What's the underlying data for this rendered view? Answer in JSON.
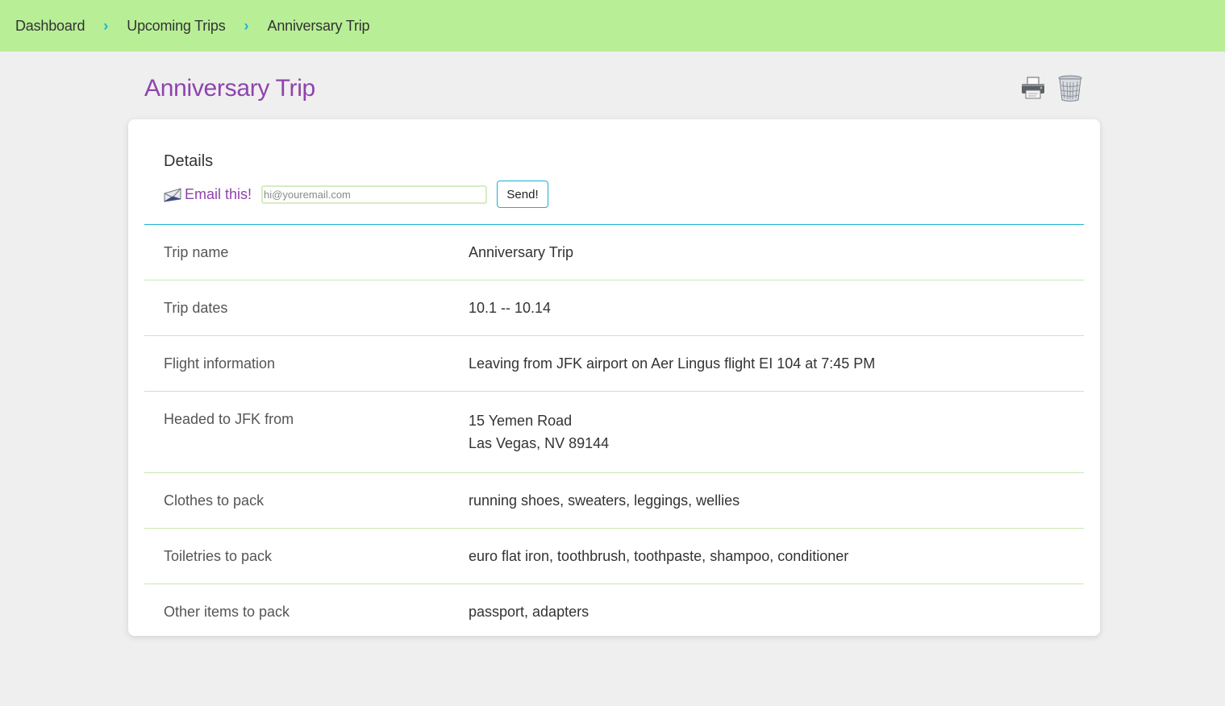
{
  "breadcrumb": {
    "items": [
      {
        "label": "Dashboard"
      },
      {
        "label": "Upcoming Trips"
      },
      {
        "label": "Anniversary Trip"
      }
    ],
    "separator": "›"
  },
  "page": {
    "title": "Anniversary Trip"
  },
  "actions": {
    "print_icon": "printer-icon",
    "delete_icon": "trash-icon"
  },
  "details": {
    "heading": "Details",
    "email": {
      "label": "Email this!",
      "icon": "envelope-icon",
      "placeholder": "hi@youremail.com",
      "value": "",
      "send_label": "Send!"
    },
    "rows": [
      {
        "label": "Trip name",
        "value": "Anniversary Trip"
      },
      {
        "label": "Trip dates",
        "value": "10.1 -- 10.14"
      },
      {
        "label": "Flight information",
        "value": "Leaving from JFK airport on Aer Lingus flight EI 104 at 7:45 PM"
      },
      {
        "label": "Headed to JFK from",
        "value_line1": "15 Yemen Road",
        "value_line2": "Las Vegas, NV 89144"
      },
      {
        "label": "Clothes to pack",
        "value": "running shoes, sweaters, leggings, wellies"
      },
      {
        "label": "Toiletries to pack",
        "value": "euro flat iron, toothbrush, toothpaste, shampoo, conditioner"
      },
      {
        "label": "Other items to pack",
        "value": "passport, adapters"
      }
    ]
  },
  "colors": {
    "header_bg": "#b8ef96",
    "title": "#8e44ad",
    "accent": "#1ab3d3",
    "row_border": "#c9e7b4"
  }
}
